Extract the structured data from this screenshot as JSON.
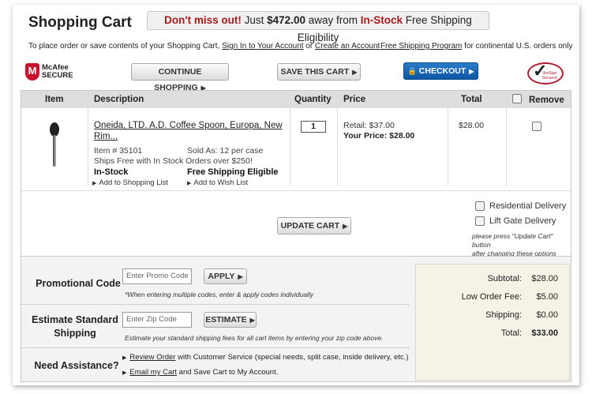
{
  "header": {
    "title": "Shopping Cart",
    "banner_prefix": "Don't miss out!",
    "banner_mid": " Just ",
    "banner_amount": "$472.00",
    "banner_away": " away from ",
    "banner_instock": "In-Stock",
    "banner_suffix": " Free Shipping Eligibility",
    "intro_pre": "To place order or save contents of your Shopping Cart, ",
    "intro_link1": "Sign In to Your Account",
    "intro_or": " or ",
    "intro_link2": "Create an Account",
    "ship_link": "Free Shipping Program",
    "ship_suffix": " for continental U.S. orders only"
  },
  "badges": {
    "mcafee_line1": "McAfee",
    "mcafee_line2": "SECURE",
    "mcafee_mark": "M",
    "verisign_line1": "VeriSign",
    "verisign_line2": "Secured"
  },
  "toolbar": {
    "continue_label": "CONTINUE SHOPPING",
    "save_label": "SAVE THIS CART",
    "checkout_label": "CHECKOUT",
    "lock_glyph": "🔒",
    "arrow_glyph": "▶"
  },
  "table": {
    "headers": {
      "item": "Item",
      "description": "Description",
      "quantity": "Quantity",
      "price": "Price",
      "total": "Total",
      "remove": "Remove"
    },
    "row": {
      "name_line1": "Oneida, LTD. A.D. Coffee Spoon, Europa, New",
      "name_line2": "Rim...",
      "item_no": "Item # 35101",
      "sold_as": "Sold As: 12 per case",
      "ships_free": "Ships Free with In Stock Orders over $250!",
      "stock": "In-Stock",
      "shipping_eligible": "Free Shipping Eligible",
      "add_list": "Add to Shopping List",
      "add_wish": "Add to Wish List",
      "quantity": "1",
      "retail": "Retail: $37.00",
      "your_price": "Your Price: $28.00",
      "total": "$28.00"
    },
    "update_label": "UPDATE CART",
    "residential": "Residential Delivery",
    "liftgate": "Lift Gate Delivery",
    "update_note_line1": "please press \"Update Cart\" button",
    "update_note_line2": "after changing these options"
  },
  "promo": {
    "label": "Promotional Code",
    "placeholder": "Enter Promo Code",
    "apply_label": "APPLY",
    "note": "*When entering multiple codes, enter & apply codes individually"
  },
  "estimate": {
    "label_line1": "Estimate Standard",
    "label_line2": "Shipping",
    "placeholder": "Enter Zip Code",
    "button_label": "ESTIMATE",
    "note": "Estimate your standard shipping fees for all cart items by entering your zip code above."
  },
  "assistance": {
    "label": "Need Assistance?",
    "link1": "Review Order",
    "text1": " with Customer Service (special needs, split case, inside delivery, etc.)",
    "link2": "Email my Cart",
    "text2": " and Save Cart to My Account."
  },
  "totals": {
    "subtotal_label": "Subtotal:",
    "subtotal": "$28.00",
    "fee_label": "Low Order Fee:",
    "fee": "$5.00",
    "shipping_label": "Shipping:",
    "shipping": "$0.00",
    "total_label": "Total:",
    "total": "$33.00"
  }
}
